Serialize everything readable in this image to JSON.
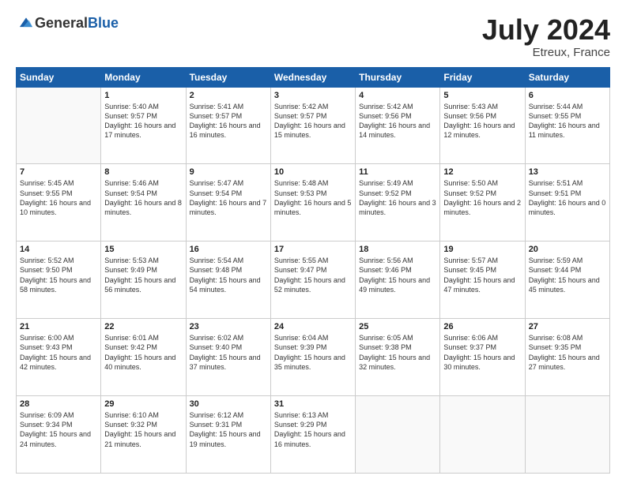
{
  "header": {
    "logo_general": "General",
    "logo_blue": "Blue",
    "month_title": "July 2024",
    "location": "Etreux, France"
  },
  "weekdays": [
    "Sunday",
    "Monday",
    "Tuesday",
    "Wednesday",
    "Thursday",
    "Friday",
    "Saturday"
  ],
  "weeks": [
    [
      {
        "day": "",
        "sunrise": "",
        "sunset": "",
        "daylight": ""
      },
      {
        "day": "1",
        "sunrise": "Sunrise: 5:40 AM",
        "sunset": "Sunset: 9:57 PM",
        "daylight": "Daylight: 16 hours and 17 minutes."
      },
      {
        "day": "2",
        "sunrise": "Sunrise: 5:41 AM",
        "sunset": "Sunset: 9:57 PM",
        "daylight": "Daylight: 16 hours and 16 minutes."
      },
      {
        "day": "3",
        "sunrise": "Sunrise: 5:42 AM",
        "sunset": "Sunset: 9:57 PM",
        "daylight": "Daylight: 16 hours and 15 minutes."
      },
      {
        "day": "4",
        "sunrise": "Sunrise: 5:42 AM",
        "sunset": "Sunset: 9:56 PM",
        "daylight": "Daylight: 16 hours and 14 minutes."
      },
      {
        "day": "5",
        "sunrise": "Sunrise: 5:43 AM",
        "sunset": "Sunset: 9:56 PM",
        "daylight": "Daylight: 16 hours and 12 minutes."
      },
      {
        "day": "6",
        "sunrise": "Sunrise: 5:44 AM",
        "sunset": "Sunset: 9:55 PM",
        "daylight": "Daylight: 16 hours and 11 minutes."
      }
    ],
    [
      {
        "day": "7",
        "sunrise": "Sunrise: 5:45 AM",
        "sunset": "Sunset: 9:55 PM",
        "daylight": "Daylight: 16 hours and 10 minutes."
      },
      {
        "day": "8",
        "sunrise": "Sunrise: 5:46 AM",
        "sunset": "Sunset: 9:54 PM",
        "daylight": "Daylight: 16 hours and 8 minutes."
      },
      {
        "day": "9",
        "sunrise": "Sunrise: 5:47 AM",
        "sunset": "Sunset: 9:54 PM",
        "daylight": "Daylight: 16 hours and 7 minutes."
      },
      {
        "day": "10",
        "sunrise": "Sunrise: 5:48 AM",
        "sunset": "Sunset: 9:53 PM",
        "daylight": "Daylight: 16 hours and 5 minutes."
      },
      {
        "day": "11",
        "sunrise": "Sunrise: 5:49 AM",
        "sunset": "Sunset: 9:52 PM",
        "daylight": "Daylight: 16 hours and 3 minutes."
      },
      {
        "day": "12",
        "sunrise": "Sunrise: 5:50 AM",
        "sunset": "Sunset: 9:52 PM",
        "daylight": "Daylight: 16 hours and 2 minutes."
      },
      {
        "day": "13",
        "sunrise": "Sunrise: 5:51 AM",
        "sunset": "Sunset: 9:51 PM",
        "daylight": "Daylight: 16 hours and 0 minutes."
      }
    ],
    [
      {
        "day": "14",
        "sunrise": "Sunrise: 5:52 AM",
        "sunset": "Sunset: 9:50 PM",
        "daylight": "Daylight: 15 hours and 58 minutes."
      },
      {
        "day": "15",
        "sunrise": "Sunrise: 5:53 AM",
        "sunset": "Sunset: 9:49 PM",
        "daylight": "Daylight: 15 hours and 56 minutes."
      },
      {
        "day": "16",
        "sunrise": "Sunrise: 5:54 AM",
        "sunset": "Sunset: 9:48 PM",
        "daylight": "Daylight: 15 hours and 54 minutes."
      },
      {
        "day": "17",
        "sunrise": "Sunrise: 5:55 AM",
        "sunset": "Sunset: 9:47 PM",
        "daylight": "Daylight: 15 hours and 52 minutes."
      },
      {
        "day": "18",
        "sunrise": "Sunrise: 5:56 AM",
        "sunset": "Sunset: 9:46 PM",
        "daylight": "Daylight: 15 hours and 49 minutes."
      },
      {
        "day": "19",
        "sunrise": "Sunrise: 5:57 AM",
        "sunset": "Sunset: 9:45 PM",
        "daylight": "Daylight: 15 hours and 47 minutes."
      },
      {
        "day": "20",
        "sunrise": "Sunrise: 5:59 AM",
        "sunset": "Sunset: 9:44 PM",
        "daylight": "Daylight: 15 hours and 45 minutes."
      }
    ],
    [
      {
        "day": "21",
        "sunrise": "Sunrise: 6:00 AM",
        "sunset": "Sunset: 9:43 PM",
        "daylight": "Daylight: 15 hours and 42 minutes."
      },
      {
        "day": "22",
        "sunrise": "Sunrise: 6:01 AM",
        "sunset": "Sunset: 9:42 PM",
        "daylight": "Daylight: 15 hours and 40 minutes."
      },
      {
        "day": "23",
        "sunrise": "Sunrise: 6:02 AM",
        "sunset": "Sunset: 9:40 PM",
        "daylight": "Daylight: 15 hours and 37 minutes."
      },
      {
        "day": "24",
        "sunrise": "Sunrise: 6:04 AM",
        "sunset": "Sunset: 9:39 PM",
        "daylight": "Daylight: 15 hours and 35 minutes."
      },
      {
        "day": "25",
        "sunrise": "Sunrise: 6:05 AM",
        "sunset": "Sunset: 9:38 PM",
        "daylight": "Daylight: 15 hours and 32 minutes."
      },
      {
        "day": "26",
        "sunrise": "Sunrise: 6:06 AM",
        "sunset": "Sunset: 9:37 PM",
        "daylight": "Daylight: 15 hours and 30 minutes."
      },
      {
        "day": "27",
        "sunrise": "Sunrise: 6:08 AM",
        "sunset": "Sunset: 9:35 PM",
        "daylight": "Daylight: 15 hours and 27 minutes."
      }
    ],
    [
      {
        "day": "28",
        "sunrise": "Sunrise: 6:09 AM",
        "sunset": "Sunset: 9:34 PM",
        "daylight": "Daylight: 15 hours and 24 minutes."
      },
      {
        "day": "29",
        "sunrise": "Sunrise: 6:10 AM",
        "sunset": "Sunset: 9:32 PM",
        "daylight": "Daylight: 15 hours and 21 minutes."
      },
      {
        "day": "30",
        "sunrise": "Sunrise: 6:12 AM",
        "sunset": "Sunset: 9:31 PM",
        "daylight": "Daylight: 15 hours and 19 minutes."
      },
      {
        "day": "31",
        "sunrise": "Sunrise: 6:13 AM",
        "sunset": "Sunset: 9:29 PM",
        "daylight": "Daylight: 15 hours and 16 minutes."
      },
      {
        "day": "",
        "sunrise": "",
        "sunset": "",
        "daylight": ""
      },
      {
        "day": "",
        "sunrise": "",
        "sunset": "",
        "daylight": ""
      },
      {
        "day": "",
        "sunrise": "",
        "sunset": "",
        "daylight": ""
      }
    ]
  ]
}
